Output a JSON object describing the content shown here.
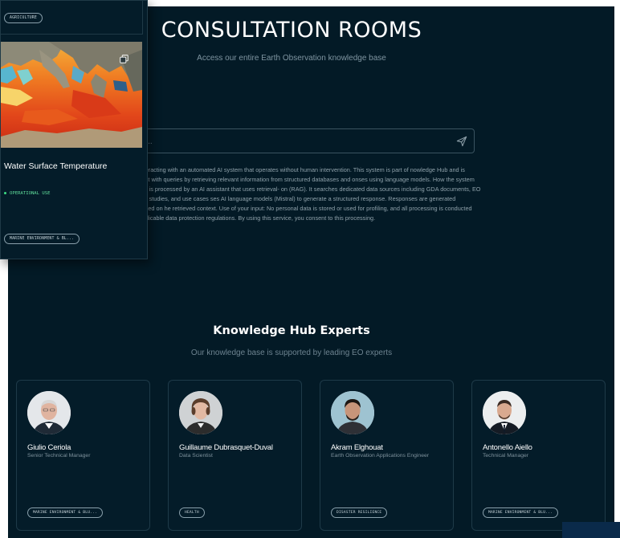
{
  "hero": {
    "title": "CONSULTATION ROOMS",
    "subtitle": "Access our entire Earth Observation knowledge base"
  },
  "search": {
    "placeholder": "e ..."
  },
  "disclaimer": "imer: You are interacting with an automated AI system that operates without human intervention. This system is part of nowledge Hub and is designed to assist with queries by retrieving relevant information from structured databases and onses using language models. How the system works: Your input is processed by an AI assistant that uses retrieval- on (RAG). It searches dedicated data sources including GDA documents, EO capabilities, case studies, and use cases ses AI language models (Mistral) to generate a structured response. Responses are generated automatically based on he retrieved context. Use of your input: No personal data is stored or used for profiling, and all processing is conducted ordance with applicable data protection regulations. By using this service, you consent to this processing.",
  "experts_section": {
    "title": "Knowledge Hub Experts",
    "subtitle": "Our knowledge base is supported by leading EO experts",
    "experts": [
      {
        "name": "Giulio Ceriola",
        "role": "Senior Technical Manager",
        "tag": "MARINE ENVIRONMENT & BLU..."
      },
      {
        "name": "Guillaume Dubrasquet-Duval",
        "role": "Data Scientist",
        "tag": "HEALTH"
      },
      {
        "name": "Akram Elghouat",
        "role": "Earth Observation Applications Engineer",
        "tag": "DISASTER RESILIENCE"
      },
      {
        "name": "Antonello Aiello",
        "role": "Technical Manager",
        "tag": "MARINE ENVIRONMENT & BLU..."
      }
    ]
  },
  "dataset_card": {
    "previous_tag": "AGRICULTURE",
    "title": "Water Surface Temperature",
    "status": "OPERATIONAL USE",
    "tag": "MARINE ENVIRONMENT & BL...",
    "icon": "copy-icon"
  },
  "colors": {
    "background": "#031a26",
    "status_green": "#3ddc84",
    "card_border": "#1e3a48"
  }
}
